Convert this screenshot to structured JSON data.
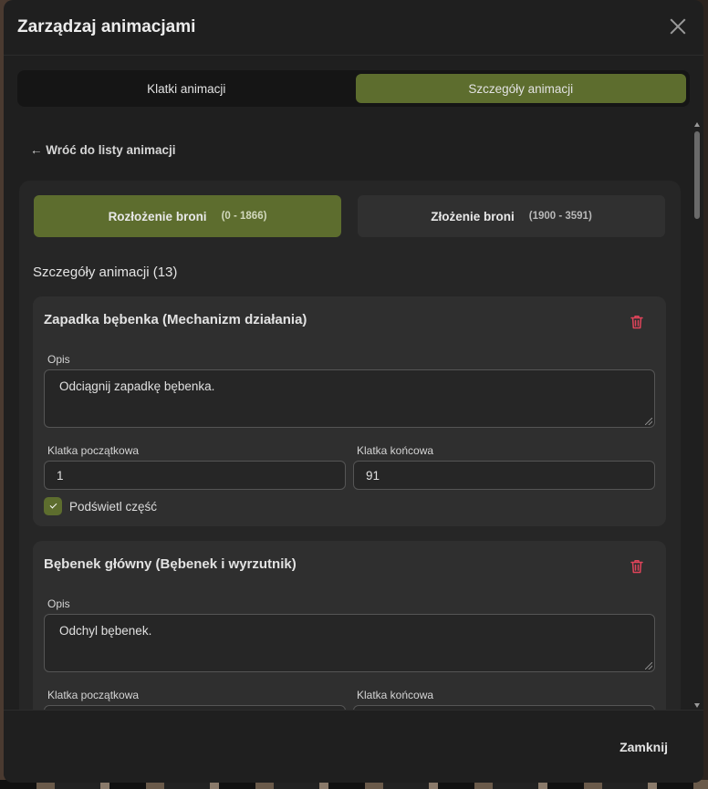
{
  "modal": {
    "title": "Zarządzaj animacjami",
    "close_icon": "close-icon"
  },
  "main_tabs": [
    {
      "label": "Klatki animacji",
      "active": false
    },
    {
      "label": "Szczegóły animacji",
      "active": true
    }
  ],
  "back_link": "← Wróć do listy animacji",
  "sub_tabs": [
    {
      "name": "Rozłożenie broni",
      "range": "(0 - 1866)",
      "active": true
    },
    {
      "name": "Złożenie broni",
      "range": "(1900 - 3591)",
      "active": false
    }
  ],
  "details_title": "Szczegóły animacji (13)",
  "labels": {
    "description": "Opis",
    "start_frame": "Klatka początkowa",
    "end_frame": "Klatka końcowa",
    "highlight": "Podświetl część"
  },
  "cards": [
    {
      "title": "Zapadka bębenka (Mechanizm działania)",
      "description": "Odciągnij zapadkę bębenka.",
      "start_frame": "1",
      "end_frame": "91",
      "highlight": true
    },
    {
      "title": "Bębenek główny (Bębenek i wyrzutnik)",
      "description": "Odchyl bębenek.",
      "start_frame": "",
      "end_frame": ""
    }
  ],
  "footer": {
    "close_label": "Zamknij"
  },
  "colors": {
    "accent": "#5d6d2e",
    "danger": "#e0445a",
    "background": "#1f1f1f"
  }
}
